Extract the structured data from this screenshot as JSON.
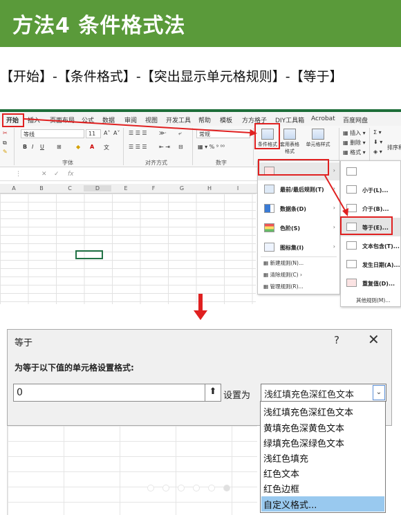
{
  "banner": {
    "title": "方法4  条件格式法",
    "color": "#5a9a3a"
  },
  "path_text": "【开始】-【条件格式】-【突出显示单元格规则】-【等于】",
  "excel": {
    "menu": [
      "开始",
      "插入",
      "页面布局",
      "公式",
      "数据",
      "审阅",
      "视图",
      "开发工具",
      "帮助",
      "模板",
      "方方格子",
      "DIY工具箱",
      "Acrobat",
      "百度网盘"
    ],
    "font_name": "等线",
    "font_size": "11",
    "number_format": "常规",
    "groups": {
      "font": "字体",
      "align": "对齐方式",
      "number": "数字"
    },
    "big_buttons": [
      "条件格式",
      "套用表格格式",
      "单元格样式"
    ],
    "cells_group": [
      "插入",
      "删除",
      "格式"
    ],
    "sort_label": "排序和",
    "col_headers": [
      "A",
      "B",
      "C",
      "D",
      "E",
      "F",
      "G",
      "H",
      "I"
    ],
    "cf_menu": {
      "items": [
        "最前/最后规则(T)",
        "数据条(D)",
        "色阶(S)",
        "图标集(I)"
      ],
      "small_items": [
        "新建规则(N)...",
        "清除规则(C)",
        "管理规则(R)..."
      ]
    },
    "sub_menu": {
      "items": [
        "小于(L)...",
        "介于(B)...",
        "等于(E)...",
        "文本包含(T)...",
        "发生日期(A)...",
        "重复值(D)..."
      ],
      "more": "其他规则(M)..."
    }
  },
  "dialog": {
    "title": "等于",
    "help": "?",
    "close": "✕",
    "heading": "为等于以下值的单元格设置格式:",
    "value": "0",
    "set_label": "设置为",
    "selected_format": "浅红填充色深红色文本",
    "options": [
      "浅红填充色深红色文本",
      "黄填充色深黄色文本",
      "绿填充色深绿色文本",
      "浅红色填充",
      "红色文本",
      "红色边框",
      "自定义格式..."
    ],
    "highlighted_option": "自定义格式..."
  },
  "colors": {
    "accent_red": "#e02020",
    "excel_green": "#217346",
    "highlight": "#99c9ef"
  }
}
